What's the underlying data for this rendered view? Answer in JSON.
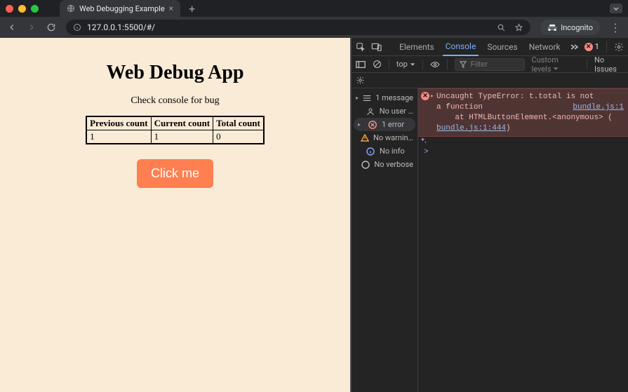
{
  "chrome": {
    "tab_title": "Web Debugging Example",
    "url": "127.0.0.1:5500/#/",
    "incognito_label": "Incognito"
  },
  "page": {
    "heading": "Web Debug App",
    "subheading": "Check console for bug",
    "table": {
      "headers": [
        "Previous count",
        "Current count",
        "Total count"
      ],
      "row": [
        "1",
        "1",
        "0"
      ]
    },
    "button_label": "Click me"
  },
  "devtools": {
    "tabs": {
      "elements": "Elements",
      "console": "Console",
      "sources": "Sources",
      "network": "Network"
    },
    "error_count": "1",
    "filterbar": {
      "context": "top",
      "filter_placeholder": "Filter",
      "levels": "Custom levels",
      "no_issues": "No Issues"
    },
    "sidebar": {
      "messages": "1 message",
      "no_user": "No user …",
      "errors": "1 error",
      "no_warnings": "No warnin…",
      "no_info": "No info",
      "no_verbose": "No verbose"
    },
    "error": {
      "text_before_link": "Uncaught TypeError: t.total is not ",
      "first_link": "bundle.js:1",
      "text_line2": "a function",
      "stack_at": "    at HTMLButtonElement.<anonymous> (",
      "stack_link": "bundle.js:1:444",
      "stack_close": ")"
    },
    "prompt": ">"
  }
}
